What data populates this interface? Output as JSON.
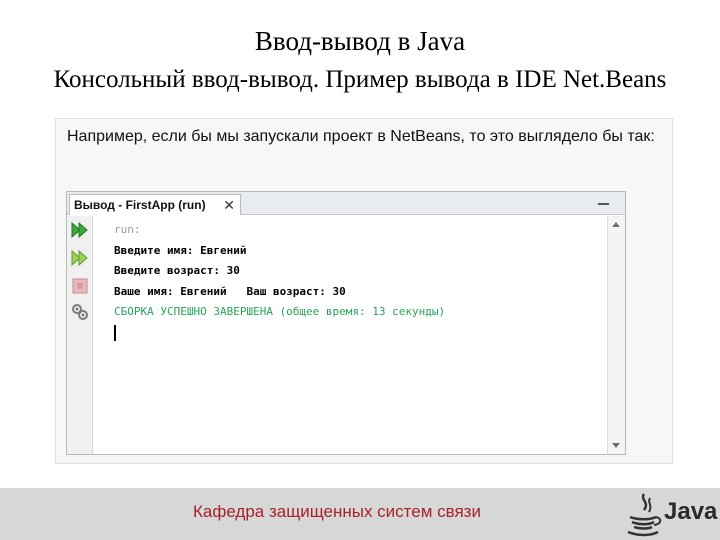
{
  "slide": {
    "title": "Ввод-вывод в Java",
    "subtitle": "Консольный ввод-вывод. Пример вывода в IDE Net.Beans"
  },
  "panel": {
    "intro_text": "Например, если бы мы запускали проект в NetBeans, то это выглядело бы так:"
  },
  "ide": {
    "tab_label": "Вывод - FirstApp (run)",
    "tab_close": "✕",
    "console_lines": [
      "run:",
      "Введите имя: Евгений",
      "Введите возраст: 30",
      "Ваше имя: Евгений   Ваш возраст: 30",
      "СБОРКА УСПЕШНО ЗАВЕРШЕНА (общее время: 13 секунды)"
    ]
  },
  "footer": {
    "department": "Кафедра защищенных систем связи",
    "logo_text": "Java"
  },
  "colors": {
    "success_text": "#25a55b",
    "footer_text": "#a8222a",
    "run_icon": "#3aa83a"
  },
  "icons": {
    "run": "run-icon",
    "rerun": "rerun-icon",
    "stop": "stop-icon",
    "settings": "settings-icon",
    "close": "close-icon",
    "minimize": "minimize-icon",
    "java_logo": "java-coffee-cup-icon"
  }
}
